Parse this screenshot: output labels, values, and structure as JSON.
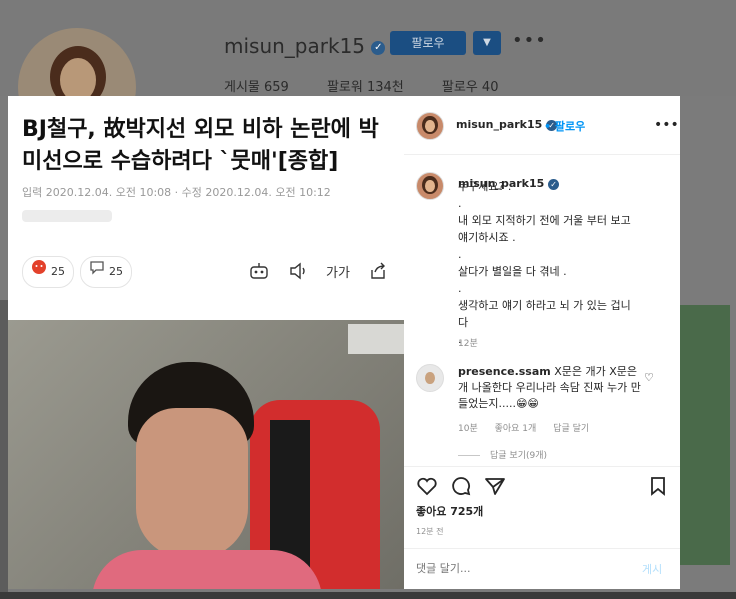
{
  "profile": {
    "username": "misun_park15",
    "follow_label": "팔로우",
    "stats": [
      "게시물 659",
      "팔로워 134천",
      "팔로우 40"
    ]
  },
  "article": {
    "title": "BJ철구, 故박지선 외모 비하 논란에 박미선으로 수습하려다 `뭇매'[종합]",
    "meta": "입력 2020.12.04. 오전 10:08 · 수정 2020.12.04. 오전 10:12",
    "reaction_count": "25",
    "comment_count": "25",
    "font_size_label": "가가"
  },
  "post": {
    "username": "misun_park15",
    "follow_label": "팔로우",
    "caption_user": "misun_park15",
    "caption": "누구세요? .\n.\n내 외모 지적하기 전에 거울 부터 보고\n얘기하시죠 .\n.\n살다가 별일을 다 겪네 .\n.\n생각하고 얘기 하라고 뇌 가 있는 겁니\n다\n.",
    "caption_time": "12분",
    "comment": {
      "user": "presence.ssam",
      "text": "X문은 개가 X문은 개 나올한다 우리나라 속담 진짜 누가 만들었는지.....😁😁",
      "time": "10분",
      "likes": "좋아요 1개",
      "reply": "답글 달기"
    },
    "view_replies": "답글 보기(9개)",
    "likes": "좋아요 725개",
    "time": "12분 전",
    "add_comment_placeholder": "댓글 달기...",
    "post_label": "게시"
  },
  "colors": {
    "accent": "#0095f6",
    "follow_bg": "#1b4e82"
  }
}
